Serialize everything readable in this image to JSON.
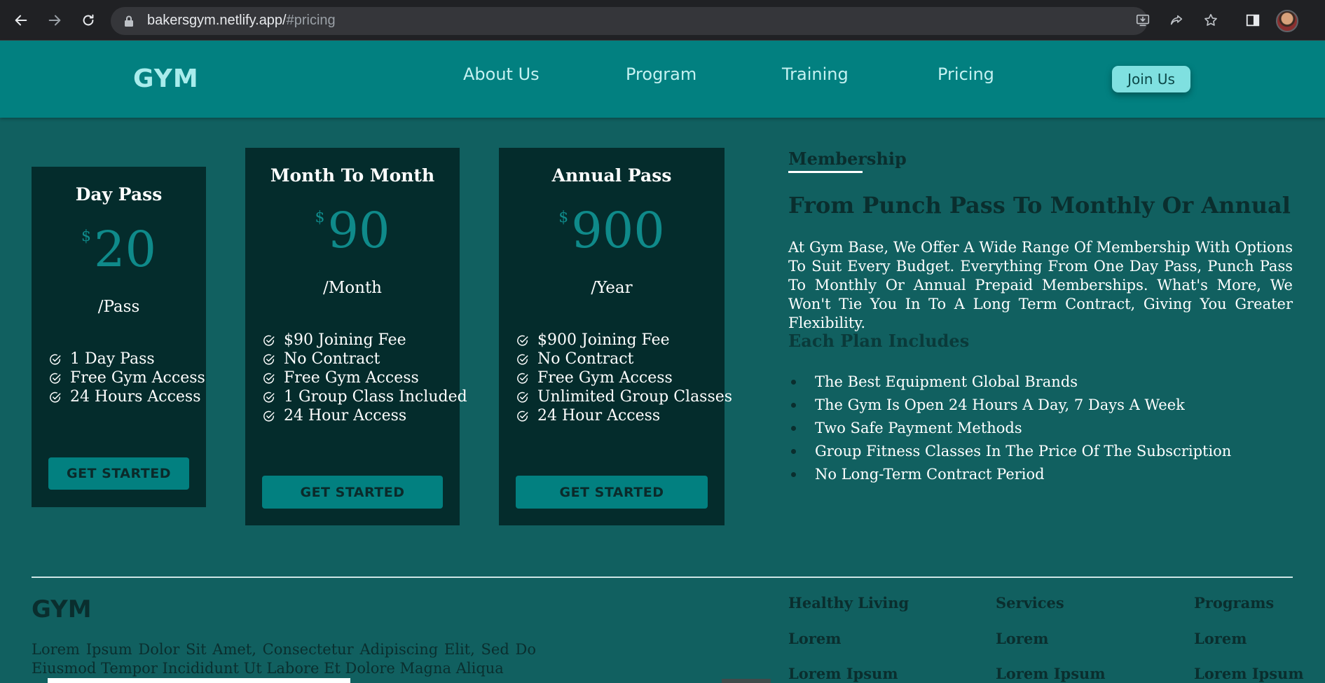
{
  "browser": {
    "url_host": "bakersgym.netlify.app/",
    "url_hash": "#pricing"
  },
  "header": {
    "logo": "GYM",
    "nav": [
      "About Us",
      "Program",
      "Training",
      "Pricing"
    ],
    "join": "Join Us"
  },
  "plans": [
    {
      "title": "Day Pass",
      "currency": "$",
      "price": "20",
      "period": "/Pass",
      "features": [
        "1 Day Pass",
        "Free Gym Access",
        "24 Hours Access"
      ],
      "cta": "GET STARTED"
    },
    {
      "title": "Month To Month",
      "currency": "$",
      "price": "90",
      "period": "/Month",
      "features": [
        "$90 Joining Fee",
        "No Contract",
        "Free Gym Access",
        "1 Group Class Included",
        "24 Hour Access"
      ],
      "cta": "GET STARTED"
    },
    {
      "title": "Annual Pass",
      "currency": "$",
      "price": "900",
      "period": "/Year",
      "features": [
        "$900 Joining Fee",
        "No Contract",
        "Free Gym Access",
        "Unlimited Group Classes",
        "24 Hour Access"
      ],
      "cta": "GET STARTED"
    }
  ],
  "membership": {
    "label": "Membership",
    "heading": "From Punch Pass To Monthly Or Annual",
    "description": "At Gym Base, We Offer A Wide Range Of Membership With Options To Suit Every Budget. Everything From One Day Pass, Punch Pass To Monthly Or Annual Prepaid Memberships. What's More, We Won't Tie You In To A Long Term Contract, Giving You Greater Flexibility.",
    "includes_heading": "Each Plan Includes",
    "includes": [
      "The Best Equipment Global Brands",
      "The Gym Is Open 24 Hours A Day, 7 Days A Week",
      "Two Safe Payment Methods",
      "Group Fitness Classes In The Price Of The Subscription",
      "No Long-Term Contract Period"
    ]
  },
  "footer": {
    "logo": "GYM",
    "text": "Lorem Ipsum Dolor Sit Amet, Consectetur Adipiscing Elit, Sed Do Eiusmod Tempor Incididunt Ut Labore Et Dolore Magna Aliqua",
    "columns": [
      {
        "heading": "Healthy Living",
        "items": [
          "Lorem",
          "Lorem Ipsum"
        ]
      },
      {
        "heading": "Services",
        "items": [
          "Lorem",
          "Lorem Ipsum"
        ]
      },
      {
        "heading": "Programs",
        "items": [
          "Lorem",
          "Lorem Ipsum"
        ]
      }
    ]
  },
  "colors": {
    "page_bg": "#116060",
    "header_bg": "#028080",
    "card_bg": "#042c2c",
    "price": "#0f8a8a",
    "join_button": "#7fe0e0"
  }
}
